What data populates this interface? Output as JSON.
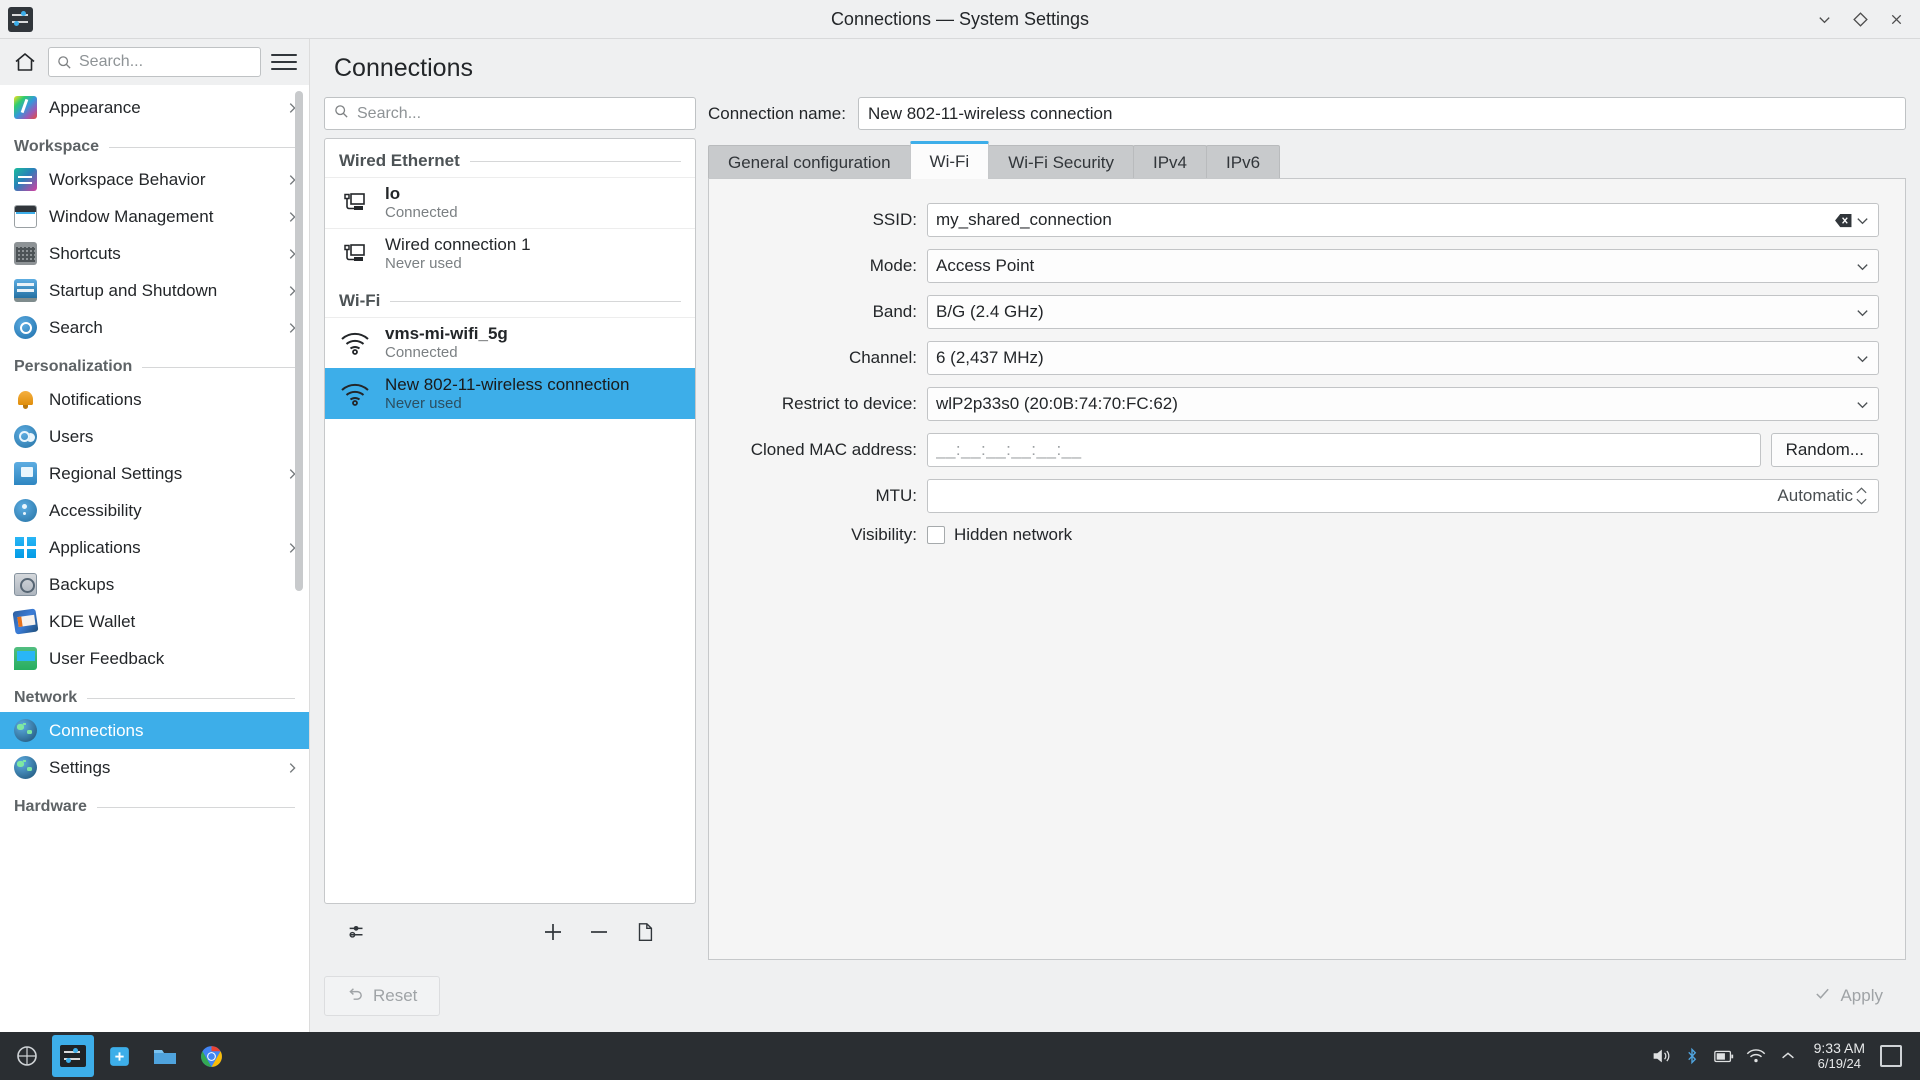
{
  "window": {
    "title": "Connections — System Settings",
    "buttons": [
      {
        "name": "minimize",
        "glyph": "minimize-icon"
      },
      {
        "name": "maximize",
        "glyph": "maximize-icon"
      },
      {
        "name": "close",
        "glyph": "close-icon"
      }
    ]
  },
  "sidebar": {
    "search_placeholder": "Search...",
    "home_icon": "home-icon",
    "menu_icon": "hamburger-icon",
    "entries": [
      {
        "type": "item",
        "label": "Appearance",
        "icon": "appearance-icon",
        "chevron": true,
        "selected": false
      },
      {
        "type": "category",
        "label": "Workspace"
      },
      {
        "type": "item",
        "label": "Workspace Behavior",
        "icon": "workspace-behavior-icon",
        "chevron": true,
        "selected": false
      },
      {
        "type": "item",
        "label": "Window Management",
        "icon": "window-management-icon",
        "chevron": true,
        "selected": false
      },
      {
        "type": "item",
        "label": "Shortcuts",
        "icon": "shortcuts-icon",
        "chevron": true,
        "selected": false
      },
      {
        "type": "item",
        "label": "Startup and Shutdown",
        "icon": "startup-shutdown-icon",
        "chevron": true,
        "selected": false
      },
      {
        "type": "item",
        "label": "Search",
        "icon": "search-icon",
        "chevron": true,
        "selected": false
      },
      {
        "type": "category",
        "label": "Personalization"
      },
      {
        "type": "item",
        "label": "Notifications",
        "icon": "notifications-bell-icon",
        "chevron": false,
        "selected": false
      },
      {
        "type": "item",
        "label": "Users",
        "icon": "users-icon",
        "chevron": false,
        "selected": false
      },
      {
        "type": "item",
        "label": "Regional Settings",
        "icon": "regional-settings-icon",
        "chevron": true,
        "selected": false
      },
      {
        "type": "item",
        "label": "Accessibility",
        "icon": "accessibility-icon",
        "chevron": false,
        "selected": false
      },
      {
        "type": "item",
        "label": "Applications",
        "icon": "applications-icon",
        "chevron": true,
        "selected": false
      },
      {
        "type": "item",
        "label": "Backups",
        "icon": "backups-icon",
        "chevron": false,
        "selected": false
      },
      {
        "type": "item",
        "label": "KDE Wallet",
        "icon": "kde-wallet-icon",
        "chevron": false,
        "selected": false
      },
      {
        "type": "item",
        "label": "User Feedback",
        "icon": "user-feedback-icon",
        "chevron": false,
        "selected": false
      },
      {
        "type": "category",
        "label": "Network"
      },
      {
        "type": "item",
        "label": "Connections",
        "icon": "globe-icon",
        "chevron": false,
        "selected": true
      },
      {
        "type": "item",
        "label": "Settings",
        "icon": "globe-icon",
        "chevron": true,
        "selected": false
      },
      {
        "type": "category",
        "label": "Hardware"
      }
    ]
  },
  "page": {
    "title": "Connections"
  },
  "connection_list": {
    "search_placeholder": "Search...",
    "groups": [
      {
        "label": "Wired Ethernet",
        "items": [
          {
            "name": "lo",
            "status": "Connected",
            "icon": "wired-ethernet-icon",
            "bold": true,
            "selected": false
          },
          {
            "name": "Wired connection 1",
            "status": "Never used",
            "icon": "wired-ethernet-icon",
            "bold": false,
            "selected": false
          }
        ]
      },
      {
        "label": "Wi-Fi",
        "items": [
          {
            "name": "vms-mi-wifi_5g",
            "status": "Connected",
            "icon": "wifi-icon",
            "bold": true,
            "selected": false
          },
          {
            "name": "New 802-11-wireless connection",
            "status": "Never used",
            "icon": "wifi-icon",
            "bold": false,
            "selected": true
          }
        ]
      }
    ],
    "toolbar": [
      {
        "name": "configure-button",
        "icon": "sliders-icon"
      },
      {
        "name": "add-connection-button",
        "icon": "plus-icon"
      },
      {
        "name": "remove-connection-button",
        "icon": "minus-icon"
      },
      {
        "name": "export-connection-button",
        "icon": "document-icon"
      }
    ]
  },
  "form": {
    "connection_name_label": "Connection name:",
    "connection_name_value": "New 802-11-wireless connection",
    "tabs": [
      {
        "label": "General configuration",
        "active": false
      },
      {
        "label": "Wi-Fi",
        "active": true
      },
      {
        "label": "Wi-Fi Security",
        "active": false
      },
      {
        "label": "IPv4",
        "active": false
      },
      {
        "label": "IPv6",
        "active": false
      }
    ],
    "fields": {
      "ssid": {
        "label": "SSID:",
        "value": "my_shared_connection",
        "clear_icon": "clear-text-icon",
        "dropdown_icon": "chevron-down-icon"
      },
      "mode": {
        "label": "Mode:",
        "value": "Access Point",
        "dropdown_icon": "chevron-down-icon"
      },
      "band": {
        "label": "Band:",
        "value": "B/G (2.4 GHz)",
        "dropdown_icon": "chevron-down-icon"
      },
      "channel": {
        "label": "Channel:",
        "value": "6 (2,437 MHz)",
        "dropdown_icon": "chevron-down-icon"
      },
      "restrict_to_device": {
        "label": "Restrict to device:",
        "value": "wlP2p33s0 (20:0B:74:70:FC:62)",
        "dropdown_icon": "chevron-down-icon"
      },
      "cloned_mac": {
        "label": "Cloned MAC address:",
        "value": "__:__:__:__:__:__",
        "button_label": "Random..."
      },
      "mtu": {
        "label": "MTU:",
        "value": "Automatic",
        "spinner_icon": "spinner-up-down-icon"
      },
      "visibility": {
        "label": "Visibility:",
        "checkbox_label": "Hidden network",
        "checked": false
      }
    }
  },
  "footer": {
    "reset_label": "Reset",
    "reset_icon": "undo-icon",
    "apply_label": "Apply",
    "apply_icon": "check-icon"
  },
  "taskbar": {
    "launchers": [
      {
        "name": "application-launcher",
        "icon": "kde-menu-icon"
      },
      {
        "name": "system-settings-task",
        "icon": "system-settings-icon",
        "active": true
      },
      {
        "name": "software-center-task",
        "icon": "discover-icon"
      },
      {
        "name": "file-manager-task",
        "icon": "folder-icon"
      },
      {
        "name": "web-browser-task",
        "icon": "chrome-icon"
      }
    ],
    "tray": [
      {
        "name": "volume-icon"
      },
      {
        "name": "bluetooth-icon"
      },
      {
        "name": "battery-icon"
      },
      {
        "name": "network-icon"
      },
      {
        "name": "show-hidden-icon"
      }
    ],
    "clock_time": "9:33 AM",
    "clock_date": "6/19/24",
    "show_desktop": "show-desktop-icon"
  },
  "colors": {
    "accent": "#3daee9",
    "window_bg": "#eff0f1",
    "panel_bg": "#f5f5f5",
    "taskbar_bg": "#2a2e32",
    "text": "#232629"
  }
}
